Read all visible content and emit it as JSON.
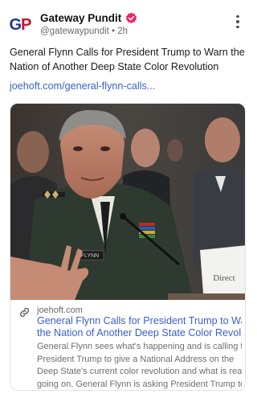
{
  "post": {
    "author": {
      "name": "Gateway Pundit",
      "handle": "@gatewaypundit",
      "time": "2h",
      "separator": "•",
      "avatar_letters": [
        "G",
        "P"
      ],
      "avatar_colors": [
        "#1e3a8a",
        "#c8102e"
      ],
      "verified_color": "#e8276b"
    },
    "text": "General Flynn Calls for President Trump to Warn the Nation of Another Deep State Color Revolution",
    "link_text": "joehoft.com/general-flynn-calls...",
    "menu_icon": "more-vertical-icon",
    "link_color": "#3a5fcd",
    "card": {
      "domain": "joehoft.com",
      "domain_icon": "link-icon",
      "title_lines": [
        "General Flynn Calls for President Trump to Warn",
        "the Nation of Another Deep State Color Revolu..."
      ],
      "description_lines": [
        "General Flynn sees what's happening and is calling for",
        "President Trump to give a National Address on the",
        "Deep State's current color revolution and what is really",
        "going on. General Flynn is asking President Trump to ..."
      ],
      "image": {
        "nameplate": "FLYNN",
        "placard": "Direct"
      }
    }
  }
}
